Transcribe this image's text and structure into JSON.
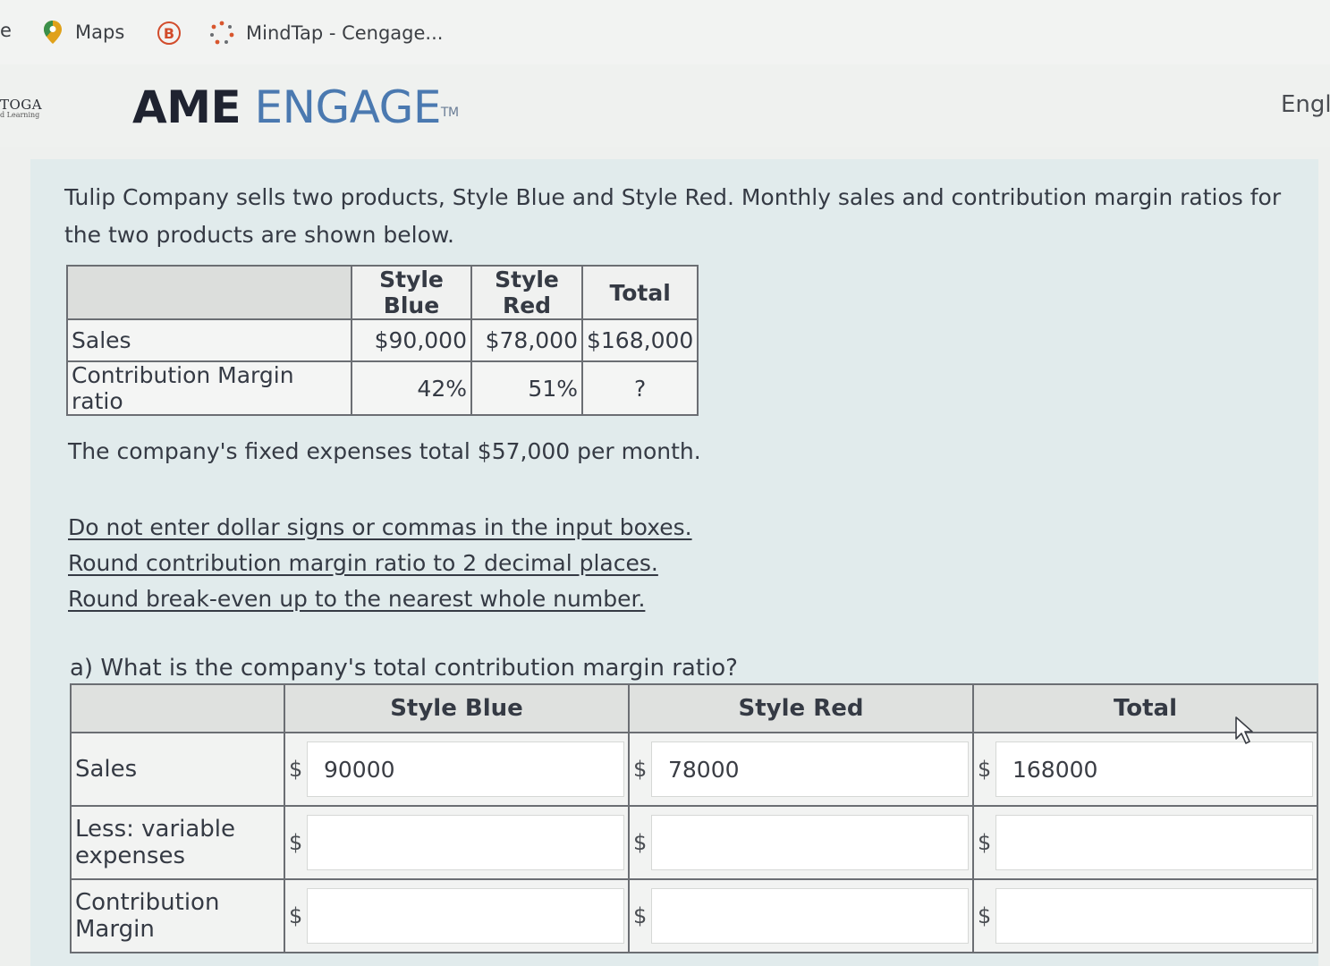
{
  "bookmarks": {
    "partial": "e",
    "maps": "Maps",
    "b_badge": "B",
    "mindtap": "MindTap - Cengage...",
    "icons": [
      "map-pin-icon",
      "b-badge-icon",
      "mindtap-icon"
    ]
  },
  "header": {
    "logo_top": "TOGA",
    "logo_bottom": "d Learning",
    "brand_bold": "AME",
    "brand_light": "ENGAGE",
    "brand_tm": "TM",
    "language": "Engli"
  },
  "problem": {
    "intro": "Tulip Company sells two products, Style Blue and Style Red. Monthly sales and contribution margin ratios for the two products are shown below.",
    "table": {
      "headers": [
        "Style Blue",
        "Style Red",
        "Total"
      ],
      "rows": [
        {
          "label": "Sales",
          "values": [
            "$90,000",
            "$78,000",
            "$168,000"
          ]
        },
        {
          "label": "Contribution Margin ratio",
          "values": [
            "42%",
            "51%",
            "?"
          ]
        }
      ]
    },
    "fixed_expenses": "The company's fixed expenses total $57,000 per month.",
    "instructions": [
      "Do not enter dollar signs or commas in the input boxes.",
      "Round contribution margin ratio to 2 decimal places.",
      "Round break-even up to the nearest whole number."
    ]
  },
  "question_a": {
    "prompt": "a) What is the company's total contribution margin ratio?",
    "headers": [
      "Style Blue",
      "Style Red",
      "Total"
    ],
    "currency": "$",
    "rows": [
      {
        "label": "Sales",
        "values": [
          "90000",
          "78000",
          "168000"
        ]
      },
      {
        "label": "Less: variable expenses",
        "values": [
          "",
          "",
          ""
        ]
      },
      {
        "label": "Contribution Margin",
        "values": [
          "",
          "",
          ""
        ]
      }
    ]
  }
}
